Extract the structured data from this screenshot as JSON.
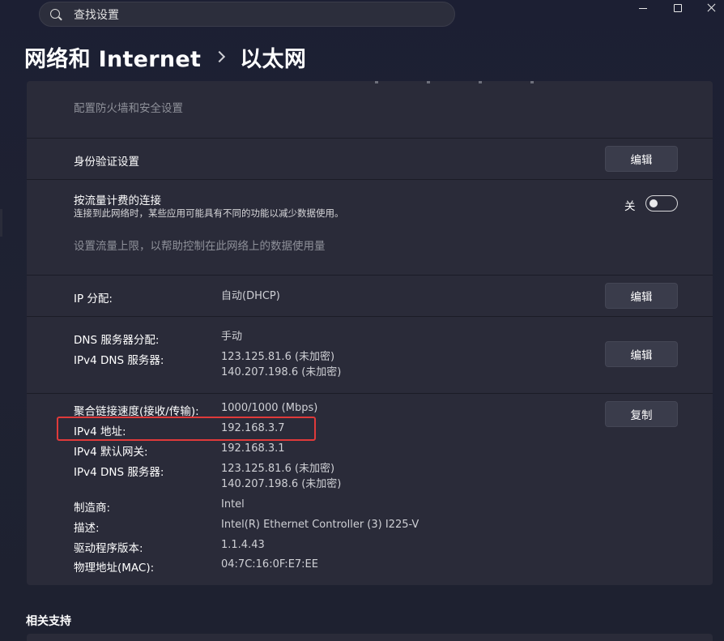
{
  "search": {
    "placeholder": "查找设置"
  },
  "breadcrumb": {
    "parent": "网络和 Internet",
    "current": "以太网"
  },
  "firewall": {
    "link": "配置防火墙和安全设置"
  },
  "auth": {
    "label": "身份验证设置",
    "button": "编辑"
  },
  "metered": {
    "label": "按流量计费的连接",
    "description": "连接到此网络时，某些应用可能具有不同的功能以减少数据使用。",
    "toggle_label": "关",
    "toggle_on": false,
    "link": "设置流量上限，以帮助控制在此网络上的数据使用量"
  },
  "ip_assignment": {
    "label": "IP 分配:",
    "value": "自动(DHCP)",
    "button": "编辑"
  },
  "dns_assignment": {
    "label": "DNS 服务器分配:",
    "value": "手动",
    "ipv4_dns_label": "IPv4 DNS 服务器:",
    "ipv4_dns_1": "123.125.81.6 (未加密)",
    "ipv4_dns_2": "140.207.198.6 (未加密)",
    "button": "编辑"
  },
  "properties": {
    "button": "复制",
    "rows": [
      {
        "label": "聚合链接速度(接收/传输):",
        "value": "1000/1000 (Mbps)"
      },
      {
        "label": "IPv4 地址:",
        "value": "192.168.3.7"
      },
      {
        "label": "IPv4 默认网关:",
        "value": "192.168.3.1"
      },
      {
        "label": "IPv4 DNS 服务器:",
        "value": "123.125.81.6 (未加密)",
        "value2": "140.207.198.6 (未加密)"
      },
      {
        "label": "制造商:",
        "value": "Intel"
      },
      {
        "label": "描述:",
        "value": "Intel(R) Ethernet Controller (3) I225-V"
      },
      {
        "label": "驱动程序版本:",
        "value": "1.1.4.43"
      },
      {
        "label": "物理地址(MAC):",
        "value": "04:7C:16:0F:E7:EE"
      }
    ]
  },
  "related": {
    "title": "相关支持"
  },
  "colors": {
    "highlight": "#e03a3a",
    "card": "#2a2b39",
    "background": "#1d2031"
  }
}
